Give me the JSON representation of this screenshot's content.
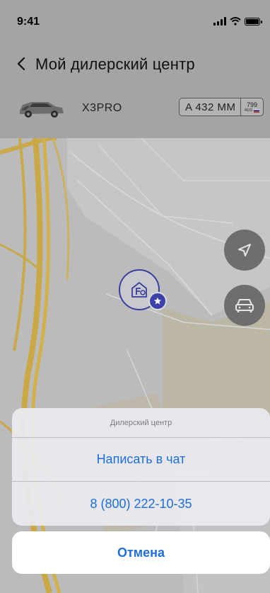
{
  "status_bar": {
    "time": "9:41",
    "icons": [
      "signal-icon",
      "wifi-icon",
      "battery-icon"
    ]
  },
  "nav": {
    "back_icon": "chevron-left-icon",
    "title": "Мой дилерский центр"
  },
  "vehicle": {
    "model": "X3PRO",
    "plate_number": "A 432 MM",
    "plate_region": "799",
    "plate_country": "RUS"
  },
  "map": {
    "controls": [
      {
        "name": "navigate-button",
        "icon": "location-arrow-icon"
      },
      {
        "name": "car-location-button",
        "icon": "car-icon"
      }
    ],
    "dealer_pin": {
      "icon": "dealer-building-icon",
      "badge_icon": "star-icon"
    }
  },
  "action_sheet": {
    "title": "Дилерский центр",
    "actions": [
      {
        "label": "Написать в чат"
      },
      {
        "label": "8 (800) 222-10-35"
      }
    ],
    "cancel_label": "Отмена"
  },
  "colors": {
    "accent": "#1e6fd9",
    "dealer_pin": "#3d40a6",
    "map_button": "#6e6e6e",
    "overlay_header": "#a4a4a4"
  }
}
